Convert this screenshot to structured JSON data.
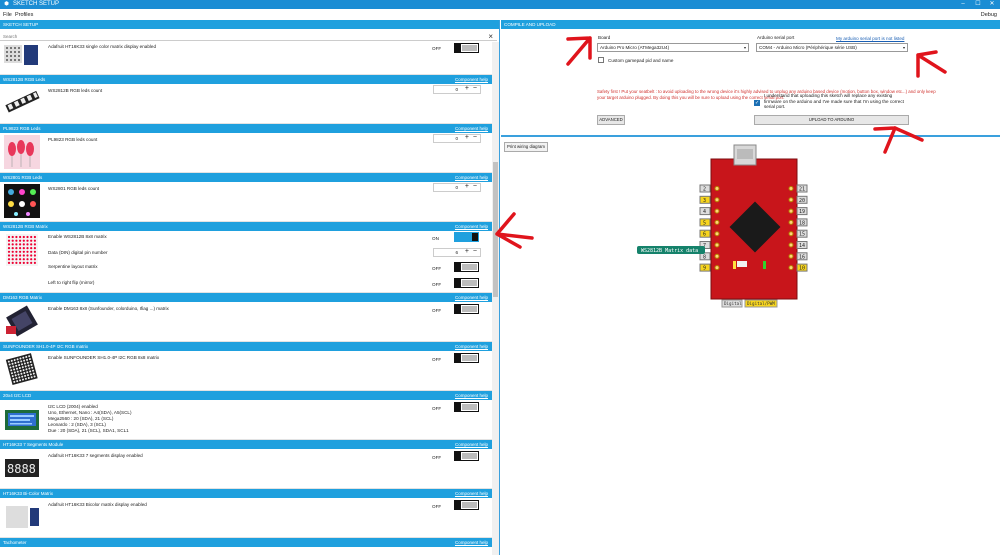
{
  "window": {
    "title": "SKETCH SETUP",
    "app_icon": "app-logo-icon"
  },
  "menu": {
    "items": [
      "File",
      "Profiles"
    ],
    "debug": "Debug"
  },
  "left": {
    "header": "SKETCH SETUP",
    "search_placeholder": "Search",
    "components": [
      {
        "title": "",
        "help": "",
        "desc": "Adafruit HT16K33 single color matrix display enabled",
        "state": "OFF"
      },
      {
        "title": "WS2812B RGB Leds",
        "help": "Component help",
        "desc": "WS2812B RGB leds count",
        "value": "0"
      },
      {
        "title": "PL9823 RGB Leds",
        "help": "Component help",
        "desc": "PL9823 RGB leds count",
        "value": "0"
      },
      {
        "title": "WS2801 RGB Leds",
        "help": "Component help",
        "desc": "WS2801 RGB leds count",
        "value": "0"
      },
      {
        "title": "WS2812B RGB Matrix",
        "help": "Component help",
        "rows": [
          {
            "label": "Enable WS2812B 8x8 matrix",
            "state": "ON"
          },
          {
            "label": "Data (DIN) digital pin number",
            "value": "6"
          },
          {
            "label": "Serpentine layout matrix",
            "state": "OFF"
          },
          {
            "label": "Left to right flip (mirror)",
            "state": "OFF"
          }
        ]
      },
      {
        "title": "DM163 RGB Matrix",
        "help": "Component help",
        "desc": "Enable DM163 8x8 (Sunfounder, colorduino, Ifiag ...) matrix",
        "state": "OFF"
      },
      {
        "title": "SUNFOUNDER SH1.0-4P I2C RGB matrix",
        "help": "Component help",
        "desc": "Enable SUNFOUNDER SH1.0-4P I2C RGB 8x8 matrix",
        "state": "OFF"
      },
      {
        "title": "20x4 I2C LCD",
        "help": "Component help",
        "lines": [
          "I2C LCD (2004) enabled",
          "Uno, Ethernet, Nano : A4(SDA), A5(SCL)",
          "Mega2560 : 20 (SDA), 21 (SCL)",
          "Leonardo : 2 (SDA), 3 (SCL)",
          "Due : 20 (SDA), 21 (SCL), SDA1, SCL1"
        ],
        "state": "OFF"
      },
      {
        "title": "HT16K33 7 Segments Module",
        "help": "Component help",
        "desc": "Adafruit HT16K33 7 segments display enabled",
        "state": "OFF"
      },
      {
        "title": "HT16K33 Bi-Color Matrix",
        "help": "Component help",
        "desc": "Adafruit HT16K33 Bicolor matrix display enabled",
        "state": "OFF"
      },
      {
        "title": "Tachometer",
        "help": "Component help"
      }
    ]
  },
  "right": {
    "header": "COMPILE AND UPLOAD",
    "board_label": "Board",
    "board_value": "Arduino Pro Micro (ATMega32U4)",
    "serial_label": "Arduino serial port",
    "serial_value": "COM4 - Arduino Micro (Périphérique série USB)",
    "serial_link": "My arduino serial port is not listed",
    "custom_pid": "Custom gamepad pid and name",
    "warning": "Safety first ! Put your seatbelt : to avoid uploading to the wrong device it's highly advised to unplug any arduino based device (motion, button box, window etc...) and only keep your target arduino plugged. By doing this you will be sure to upload using the correct serial port.",
    "confirm": "I understand that uploading this sketch will replace any existing firmware on the arduino and I've made sure that I'm using the correct serial port.",
    "advanced_btn": "ADVANCED",
    "upload_btn": "UPLOAD TO ARDUINO",
    "wiring_btn": "Print wiring diagram",
    "pin_label": "WS2812B Matrix data",
    "legend_digital": "Digital",
    "legend_pwm": "Digital/PWM",
    "left_pins": [
      "2",
      "3",
      "4",
      "5",
      "6",
      "7",
      "8",
      "9"
    ],
    "right_pins": [
      "21",
      "20",
      "19",
      "18",
      "15",
      "14",
      "16",
      "10"
    ]
  }
}
